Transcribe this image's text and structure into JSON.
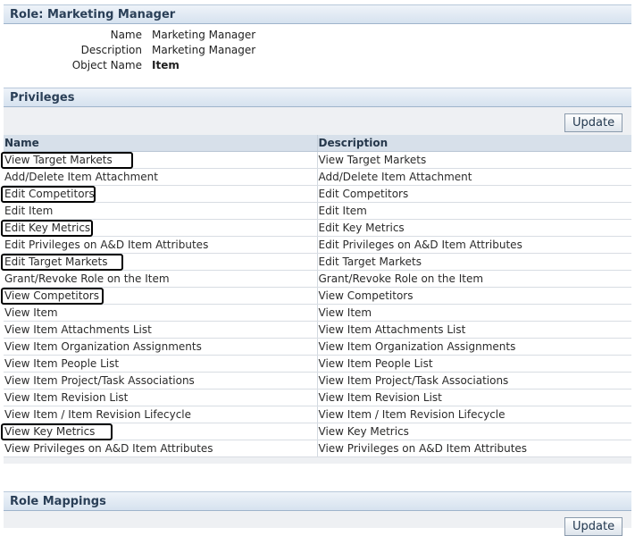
{
  "role": {
    "header": "Role: Marketing Manager",
    "fields": [
      {
        "label": "Name",
        "value": "Marketing Manager"
      },
      {
        "label": "Description",
        "value": "Marketing Manager"
      },
      {
        "label": "Object Name",
        "value": "Item"
      }
    ]
  },
  "privileges": {
    "header": "Privileges",
    "update_label": "Update",
    "columns": [
      "Name",
      "Description"
    ],
    "rows": [
      {
        "name": "View Target Markets",
        "description": "View Target Markets"
      },
      {
        "name": "Add/Delete Item Attachment",
        "description": "Add/Delete Item Attachment"
      },
      {
        "name": "Edit Competitors",
        "description": "Edit Competitors"
      },
      {
        "name": "Edit Item",
        "description": "Edit Item"
      },
      {
        "name": "Edit Key Metrics",
        "description": "Edit Key Metrics"
      },
      {
        "name": "Edit Privileges on A&D Item Attributes",
        "description": "Edit Privileges on A&D Item Attributes"
      },
      {
        "name": "Edit Target Markets",
        "description": "Edit Target Markets"
      },
      {
        "name": "Grant/Revoke Role on the Item",
        "description": "Grant/Revoke Role on the Item"
      },
      {
        "name": "View Competitors",
        "description": "View Competitors"
      },
      {
        "name": "View Item",
        "description": "View Item"
      },
      {
        "name": "View Item Attachments List",
        "description": "View Item Attachments List"
      },
      {
        "name": "View Item Organization Assignments",
        "description": "View Item Organization Assignments"
      },
      {
        "name": "View Item People List",
        "description": "View Item People List"
      },
      {
        "name": "View Item Project/Task Associations",
        "description": "View Item Project/Task Associations"
      },
      {
        "name": "View Item Revision List",
        "description": "View Item Revision List"
      },
      {
        "name": "View Item / Item Revision Lifecycle",
        "description": "View Item / Item Revision Lifecycle"
      },
      {
        "name": "View Key Metrics",
        "description": "View Key Metrics"
      },
      {
        "name": "View Privileges on A&D Item Attributes",
        "description": "View Privileges on A&D Item Attributes"
      }
    ]
  },
  "role_mappings": {
    "header": "Role Mappings",
    "update_label": "Update"
  }
}
